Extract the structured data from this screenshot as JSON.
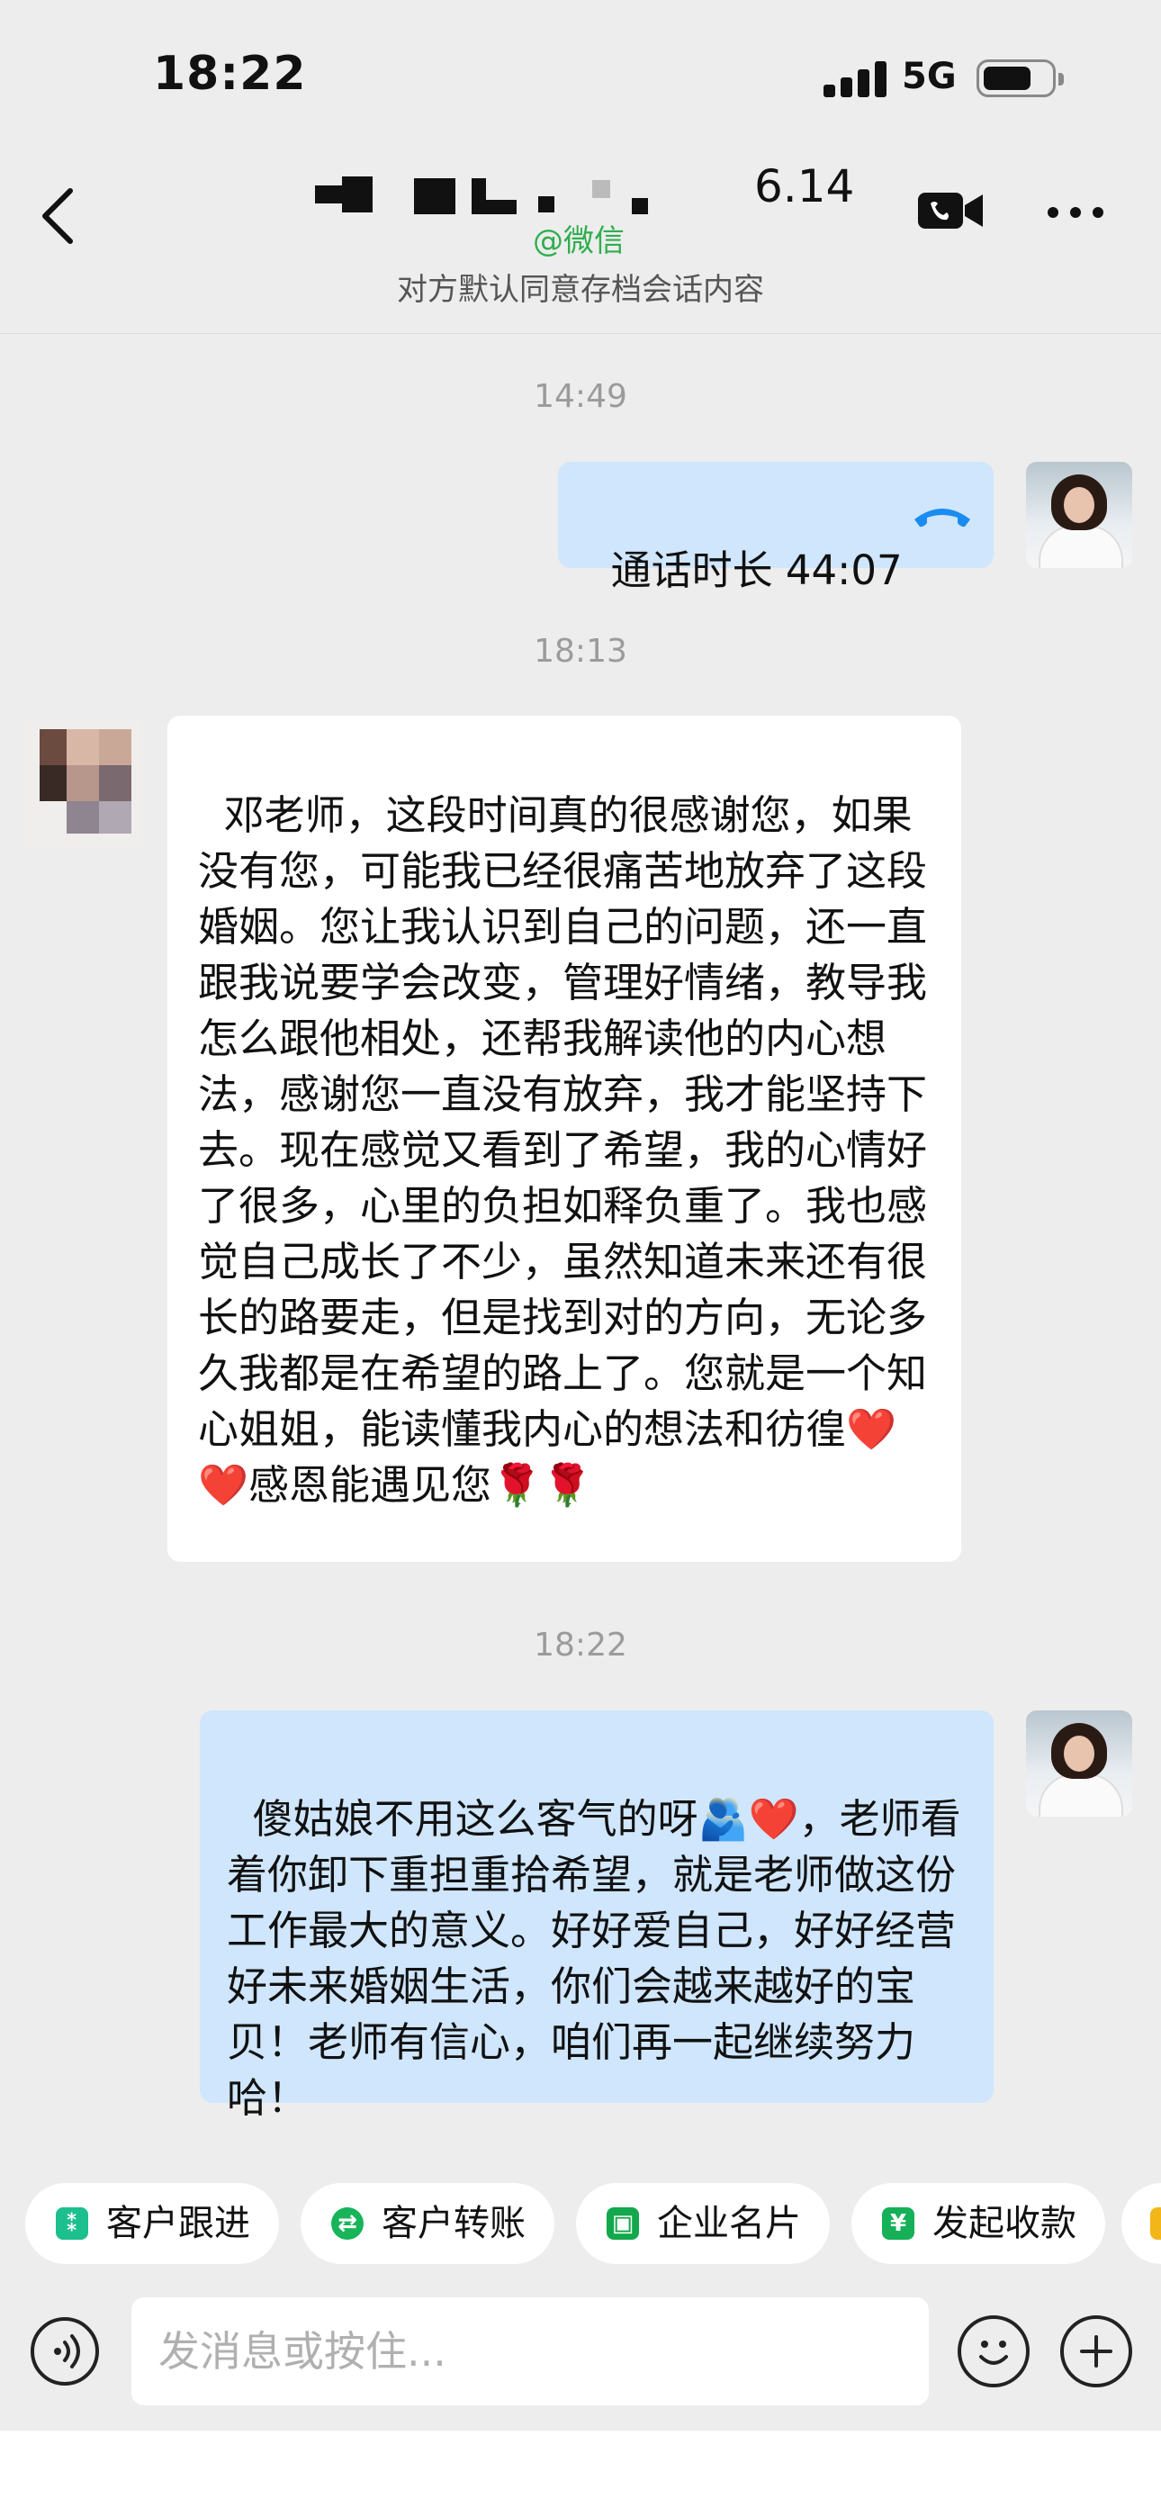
{
  "status_bar": {
    "time": "18:22",
    "network": "5G"
  },
  "header": {
    "title_suffix": "6.14",
    "wechat_tag": "@微信",
    "subtitle": "对方默认同意存档会话内容"
  },
  "messages": {
    "ts1": "14:49",
    "call_text": "通话时长 44:07",
    "ts2": "18:13",
    "incoming_text": "邓老师，这段时间真的很感谢您，如果没有您，可能我已经很痛苦地放弃了这段婚姻。您让我认识到自己的问题，还一直跟我说要学会改变，管理好情绪，教导我怎么跟他相处，还帮我解读他的内心想法，感谢您一直没有放弃，我才能坚持下去。现在感觉又看到了希望，我的心情好了很多，心里的负担如释负重了。我也感觉自己成长了不少，虽然知道未来还有很长的路要走，但是找到对的方向，无论多久我都是在希望的路上了。您就是一个知心姐姐，能读懂我内心的想法和彷徨❤️❤️感恩能遇见您🌹🌹",
    "ts3": "18:22",
    "outgoing_text": "傻姑娘不用这么客气的呀🫂❤️，老师看着你卸下重担重拾希望，就是老师做这份工作最大的意义。好好爱自己，好好经营好未来婚姻生活，你们会越来越好的宝贝！老师有信心，咱们再一起继续努力哈！"
  },
  "quick_actions": [
    {
      "label": "客户跟进",
      "icon": "customer-followup-icon",
      "color": "#1dbf8e"
    },
    {
      "label": "客户转账",
      "icon": "transfer-icon",
      "color": "#17b45a"
    },
    {
      "label": "企业名片",
      "icon": "business-card-icon",
      "color": "#12a84b"
    },
    {
      "label": "发起收款",
      "icon": "payment-icon",
      "color": "#16b058"
    }
  ],
  "input": {
    "placeholder": "发消息或按住..."
  }
}
